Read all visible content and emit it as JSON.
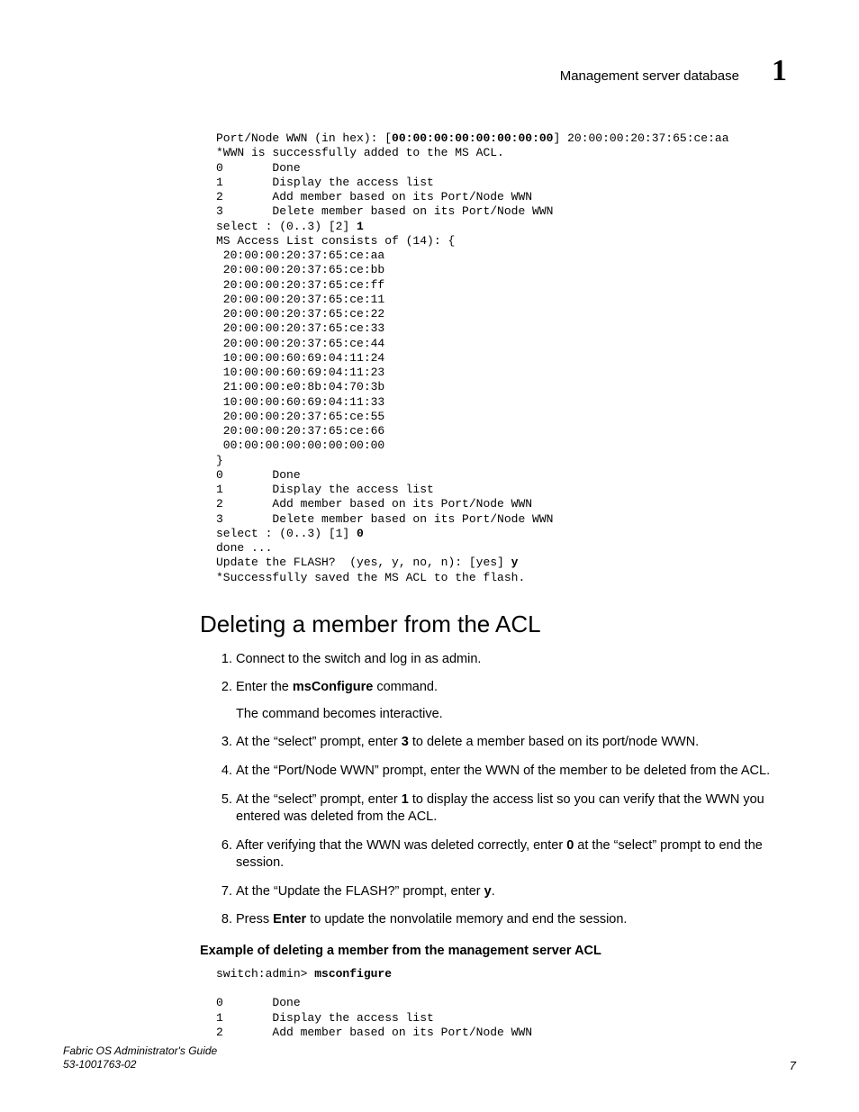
{
  "header": {
    "running_title": "Management server database",
    "chapter_number": "1"
  },
  "code_block_top": "Port/Node WWN (in hex): [<b>00:00:00:00:00:00:00:00</b>] 20:00:00:20:37:65:ce:aa\n*WWN is successfully added to the MS ACL.\n0       Done\n1       Display the access list\n2       Add member based on its Port/Node WWN\n3       Delete member based on its Port/Node WWN\nselect : (0..3) [2] <b>1</b>\nMS Access List consists of (14): {\n 20:00:00:20:37:65:ce:aa\n 20:00:00:20:37:65:ce:bb\n 20:00:00:20:37:65:ce:ff\n 20:00:00:20:37:65:ce:11\n 20:00:00:20:37:65:ce:22\n 20:00:00:20:37:65:ce:33\n 20:00:00:20:37:65:ce:44\n 10:00:00:60:69:04:11:24\n 10:00:00:60:69:04:11:23\n 21:00:00:e0:8b:04:70:3b\n 10:00:00:60:69:04:11:33\n 20:00:00:20:37:65:ce:55\n 20:00:00:20:37:65:ce:66\n 00:00:00:00:00:00:00:00\n}\n0       Done\n1       Display the access list\n2       Add member based on its Port/Node WWN\n3       Delete member based on its Port/Node WWN\nselect : (0..3) [1] <b>0</b>\ndone ...\nUpdate the FLASH?  (yes, y, no, n): [yes] <b>y</b>\n*Successfully saved the MS ACL to the flash.",
  "section_heading": "Deleting a member from the ACL",
  "steps": [
    {
      "html": "Connect to the switch and log in as admin."
    },
    {
      "html": "Enter the <b>msConfigure</b> command.",
      "sub": "The command becomes interactive."
    },
    {
      "html": "At the “select” prompt, enter <b>3</b> to delete a member based on its port/node WWN."
    },
    {
      "html": "At the “Port/Node WWN” prompt, enter the WWN of the member to be deleted from the ACL."
    },
    {
      "html": "At the “select” prompt, enter <b>1</b> to display the access list so you can verify that the WWN you entered was deleted from the ACL."
    },
    {
      "html": "After verifying that the WWN was deleted correctly, enter <b>0</b> at the “select” prompt to end the session."
    },
    {
      "html": "At the “Update the FLASH?” prompt, enter <b>y</b>."
    },
    {
      "html": "Press <b>Enter</b> to update the nonvolatile memory and end the session."
    }
  ],
  "example_title": "Example of deleting a member from the management server ACL",
  "code_block_bottom": "switch:admin> <b>msconfigure</b>\n\n0       Done\n1       Display the access list\n2       Add member based on its Port/Node WWN",
  "footer": {
    "line1": "Fabric OS Administrator's Guide",
    "line2": "53-1001763-02",
    "page": "7"
  }
}
